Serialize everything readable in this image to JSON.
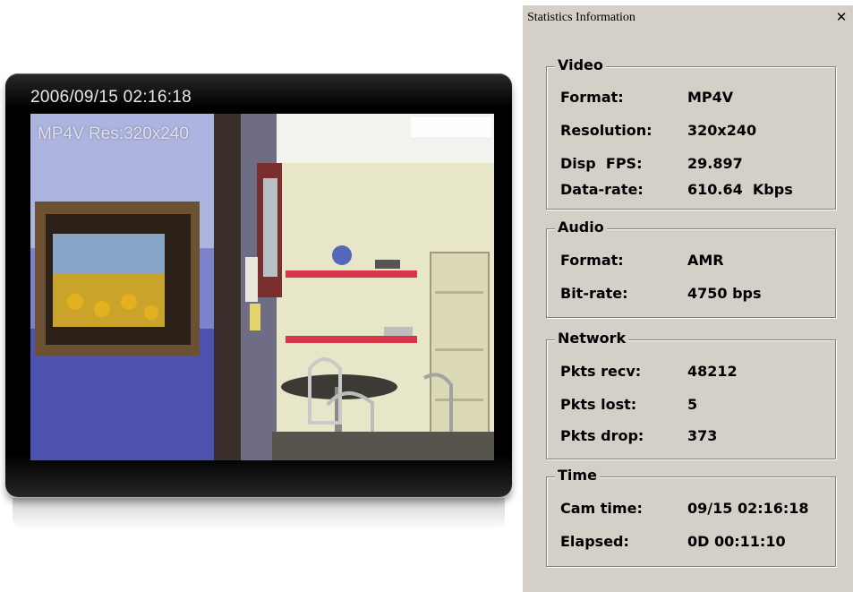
{
  "viewer": {
    "timestamp": "2006/09/15 02:16:18",
    "overlay": "MP4V Res:320x240"
  },
  "dialog": {
    "title": "Statistics Information",
    "close_glyph": "✕",
    "video": {
      "label": "Video",
      "rows": [
        {
          "key": "Format:",
          "value": "MP4V"
        },
        {
          "key": "Resolution:",
          "value": "320x240"
        },
        {
          "key": "Disp  FPS:",
          "value": "29.897"
        },
        {
          "key": "Data-rate:",
          "value": "610.64  Kbps"
        }
      ]
    },
    "audio": {
      "label": "Audio",
      "rows": [
        {
          "key": "Format:",
          "value": "AMR"
        },
        {
          "key": "Bit-rate:",
          "value": "4750 bps"
        }
      ]
    },
    "network": {
      "label": "Network",
      "rows": [
        {
          "key": "Pkts recv:",
          "value": "48212"
        },
        {
          "key": "Pkts lost:",
          "value": "5"
        },
        {
          "key": "Pkts drop:",
          "value": "373"
        }
      ]
    },
    "time": {
      "label": "Time",
      "rows": [
        {
          "key": "Cam time:",
          "value": "09/15 02:16:18"
        },
        {
          "key": "Elapsed:",
          "value": "0D 00:11:10"
        }
      ]
    }
  }
}
